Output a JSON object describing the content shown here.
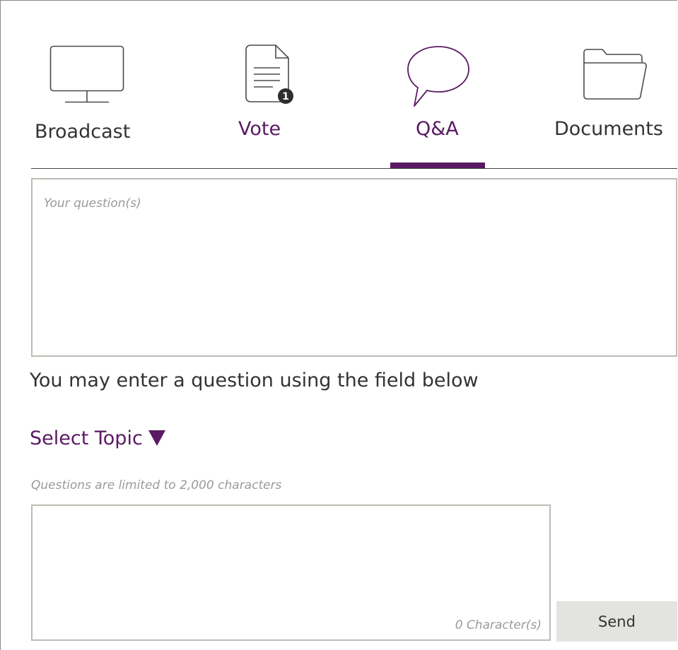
{
  "colors": {
    "accent": "#5a1a63",
    "text": "#333333",
    "muted": "#9a9a9a",
    "border": "#bdbdb5",
    "button_bg": "#e3e3e1"
  },
  "tabs": [
    {
      "id": "broadcast",
      "label": "Broadcast",
      "icon": "monitor-icon",
      "active": false
    },
    {
      "id": "vote",
      "label": "Vote",
      "icon": "document-icon",
      "badge": "1",
      "active": false
    },
    {
      "id": "qa",
      "label": "Q&A",
      "icon": "speech-bubble-icon",
      "active": true
    },
    {
      "id": "documents",
      "label": "Documents",
      "icon": "folder-icon",
      "active": false
    }
  ],
  "qa": {
    "questions_placeholder": "Your question(s)",
    "instructions": "You may enter a question using the field below",
    "select_topic_label": "Select Topic",
    "limit_note": "Questions are limited to 2,000 characters",
    "input_value": "",
    "char_count": "0 Character(s)",
    "send_label": "Send"
  }
}
